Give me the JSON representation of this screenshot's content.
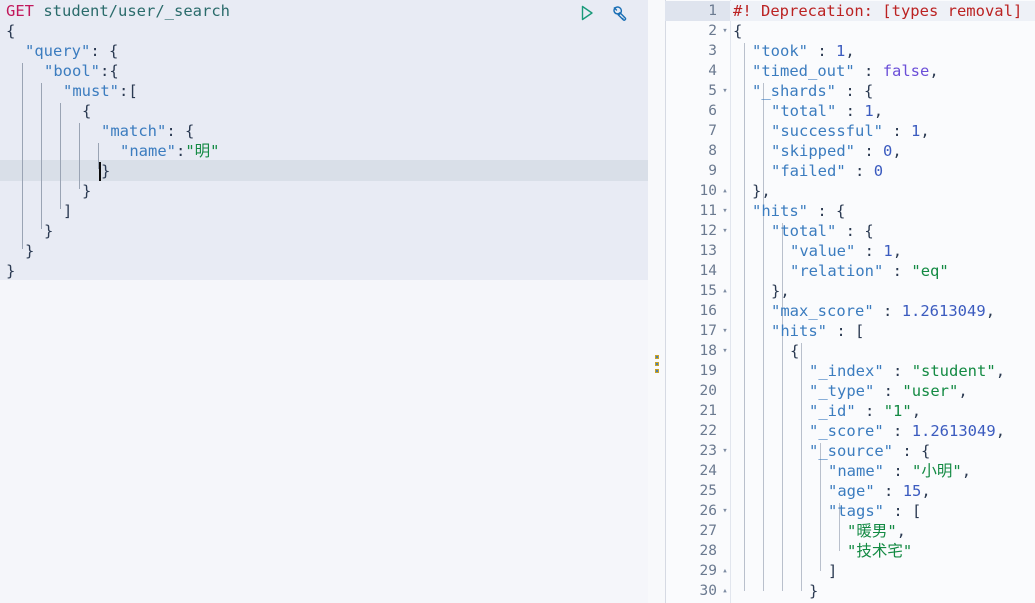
{
  "app": {
    "name": "Kibana Dev Tools Console",
    "theme": "light"
  },
  "colors": {
    "method": "#c2185b",
    "path": "#2a6b6b",
    "key": "#3b7cbf",
    "string": "#138a43",
    "number": "#3b5bbf",
    "boolean": "#6b4fd8",
    "warning": "#bb2222",
    "editor_bg": "#e8ebf4",
    "editor_page_bg": "#f5f6fa",
    "output_bg": "#fafbfd",
    "active_line_bg": "#d9dfe8",
    "play_icon": "#1a9a7a",
    "wrench_icon": "#1a6fb5"
  },
  "request_editor": {
    "name": "console-request-editor",
    "method": "GET",
    "path": "student/user/_search",
    "active_line_number": 9,
    "cursor_line": 9,
    "lines": [
      {
        "n": 1,
        "indent": 0,
        "text": "GET student/user/_search",
        "type": "request-line"
      },
      {
        "n": 2,
        "indent": 0,
        "text": "{",
        "type": "punc"
      },
      {
        "n": 3,
        "indent": 1,
        "text": "\"query\": {",
        "type": "key-open"
      },
      {
        "n": 4,
        "indent": 2,
        "text": "\"bool\":{",
        "type": "key-open"
      },
      {
        "n": 5,
        "indent": 3,
        "text": "\"must\":[",
        "type": "key-open"
      },
      {
        "n": 6,
        "indent": 4,
        "text": "{",
        "type": "punc"
      },
      {
        "n": 7,
        "indent": 5,
        "text": "\"match\": {",
        "type": "key-open"
      },
      {
        "n": 8,
        "indent": 6,
        "text": "\"name\":\"明\"",
        "type": "key-value"
      },
      {
        "n": 9,
        "indent": 5,
        "text": "}",
        "type": "punc"
      },
      {
        "n": 10,
        "indent": 4,
        "text": "}",
        "type": "punc"
      },
      {
        "n": 11,
        "indent": 3,
        "text": "]",
        "type": "punc"
      },
      {
        "n": 12,
        "indent": 2,
        "text": "}",
        "type": "punc"
      },
      {
        "n": 13,
        "indent": 1,
        "text": "}",
        "type": "punc"
      },
      {
        "n": 14,
        "indent": 0,
        "text": "}",
        "type": "punc"
      }
    ],
    "query_body": {
      "query": {
        "bool": {
          "must": [
            {
              "match": {
                "name": "明"
              }
            }
          ]
        }
      }
    },
    "actions": [
      {
        "name": "send-request-button",
        "icon": "play-icon",
        "label": "Click to send request",
        "color": "#1a9a7a"
      },
      {
        "name": "wrench-button",
        "icon": "wrench-icon",
        "label": "Open documentation / options",
        "color": "#1a6fb5"
      }
    ]
  },
  "response_editor": {
    "name": "console-response-output",
    "highlighted_line": 1,
    "first_visible_line": 1,
    "last_visible_line": 30,
    "lines": [
      {
        "n": 1,
        "fold": "",
        "indent": 0,
        "text": "#! Deprecation: [types removal]",
        "kind": "warning"
      },
      {
        "n": 2,
        "fold": "▾",
        "indent": 0,
        "text": "{",
        "kind": "punc"
      },
      {
        "n": 3,
        "fold": "",
        "indent": 1,
        "text": "\"took\" : 1,",
        "kind": "kv"
      },
      {
        "n": 4,
        "fold": "",
        "indent": 1,
        "text": "\"timed_out\" : false,",
        "kind": "kv"
      },
      {
        "n": 5,
        "fold": "▾",
        "indent": 1,
        "text": "\"_shards\" : {",
        "kind": "kv"
      },
      {
        "n": 6,
        "fold": "",
        "indent": 2,
        "text": "\"total\" : 1,",
        "kind": "kv"
      },
      {
        "n": 7,
        "fold": "",
        "indent": 2,
        "text": "\"successful\" : 1,",
        "kind": "kv"
      },
      {
        "n": 8,
        "fold": "",
        "indent": 2,
        "text": "\"skipped\" : 0,",
        "kind": "kv"
      },
      {
        "n": 9,
        "fold": "",
        "indent": 2,
        "text": "\"failed\" : 0",
        "kind": "kv"
      },
      {
        "n": 10,
        "fold": "▴",
        "indent": 1,
        "text": "},",
        "kind": "punc"
      },
      {
        "n": 11,
        "fold": "▾",
        "indent": 1,
        "text": "\"hits\" : {",
        "kind": "kv"
      },
      {
        "n": 12,
        "fold": "▾",
        "indent": 2,
        "text": "\"total\" : {",
        "kind": "kv"
      },
      {
        "n": 13,
        "fold": "",
        "indent": 3,
        "text": "\"value\" : 1,",
        "kind": "kv"
      },
      {
        "n": 14,
        "fold": "",
        "indent": 3,
        "text": "\"relation\" : \"eq\"",
        "kind": "kv"
      },
      {
        "n": 15,
        "fold": "▴",
        "indent": 2,
        "text": "},",
        "kind": "punc"
      },
      {
        "n": 16,
        "fold": "",
        "indent": 2,
        "text": "\"max_score\" : 1.2613049,",
        "kind": "kv"
      },
      {
        "n": 17,
        "fold": "▾",
        "indent": 2,
        "text": "\"hits\" : [",
        "kind": "kv"
      },
      {
        "n": 18,
        "fold": "▾",
        "indent": 3,
        "text": "{",
        "kind": "punc"
      },
      {
        "n": 19,
        "fold": "",
        "indent": 4,
        "text": "\"_index\" : \"student\",",
        "kind": "kv"
      },
      {
        "n": 20,
        "fold": "",
        "indent": 4,
        "text": "\"_type\" : \"user\",",
        "kind": "kv"
      },
      {
        "n": 21,
        "fold": "",
        "indent": 4,
        "text": "\"_id\" : \"1\",",
        "kind": "kv"
      },
      {
        "n": 22,
        "fold": "",
        "indent": 4,
        "text": "\"_score\" : 1.2613049,",
        "kind": "kv"
      },
      {
        "n": 23,
        "fold": "▾",
        "indent": 4,
        "text": "\"_source\" : {",
        "kind": "kv"
      },
      {
        "n": 24,
        "fold": "",
        "indent": 5,
        "text": "\"name\" : \"小明\",",
        "kind": "kv"
      },
      {
        "n": 25,
        "fold": "",
        "indent": 5,
        "text": "\"age\" : 15,",
        "kind": "kv"
      },
      {
        "n": 26,
        "fold": "▾",
        "indent": 5,
        "text": "\"tags\" : [",
        "kind": "kv"
      },
      {
        "n": 27,
        "fold": "",
        "indent": 6,
        "text": "\"暖男\",",
        "kind": "str"
      },
      {
        "n": 28,
        "fold": "",
        "indent": 6,
        "text": "\"技术宅\"",
        "kind": "str"
      },
      {
        "n": 29,
        "fold": "▴",
        "indent": 5,
        "text": "]",
        "kind": "punc"
      },
      {
        "n": 30,
        "fold": "▴",
        "indent": 4,
        "text": "}",
        "kind": "punc"
      }
    ],
    "response_body": {
      "took": 1,
      "timed_out": false,
      "_shards": {
        "total": 1,
        "successful": 1,
        "skipped": 0,
        "failed": 0
      },
      "hits": {
        "total": {
          "value": 1,
          "relation": "eq"
        },
        "max_score": 1.2613049,
        "hits": [
          {
            "_index": "student",
            "_type": "user",
            "_id": "1",
            "_score": 1.2613049,
            "_source": {
              "name": "小明",
              "age": 15,
              "tags": [
                "暖男",
                "技术宅"
              ]
            }
          }
        ]
      }
    },
    "deprecation_warning": "#! Deprecation: [types removal]"
  },
  "splitter": {
    "name": "pane-splitter",
    "icon": "grip-dots-icon",
    "orientation": "vertical"
  }
}
